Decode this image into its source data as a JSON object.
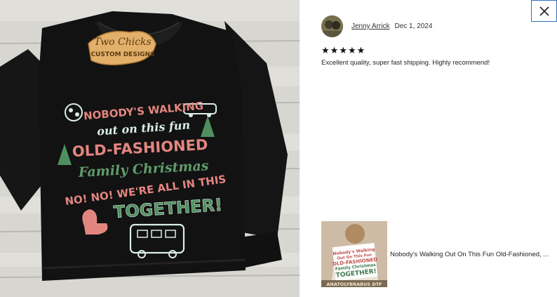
{
  "photo": {
    "tag_line1": "Two Chicks",
    "tag_line2": "CUSTOM DESIGNS",
    "print_lines": [
      "NOBODY'S WALKING",
      "out on this fun",
      "OLD-FASHIONED",
      "Family Christmas",
      "NO! NO! WE'RE ALL IN THIS",
      "TOGETHER!"
    ]
  },
  "review": {
    "reviewer_name": "Jenny Arrick",
    "date": "Dec 1, 2024",
    "rating": 5,
    "stars": [
      "★",
      "★",
      "★",
      "★",
      "★"
    ],
    "text": "Excellent quality, super fast shipping. Highly recommend!"
  },
  "item": {
    "title": "Nobody's Walking Out On This Fun Old-Fashioned, ...",
    "thumb_caption": "ANATOLYBRABUS DTF",
    "thumb_lines": [
      "Nobody's Walking",
      "Out On This Fun",
      "OLD-FASHIONED",
      "Family Christmas",
      "TOGETHER!"
    ]
  },
  "icons": {
    "close": "close-icon",
    "star": "star-icon"
  },
  "colors": {
    "close_border": "#2f6fc4",
    "shirt": "#121212",
    "print_pink": "#e3857f",
    "print_green": "#4f8f5e",
    "print_mint": "#d9eee4",
    "tag_wood": "#e2b06a"
  }
}
